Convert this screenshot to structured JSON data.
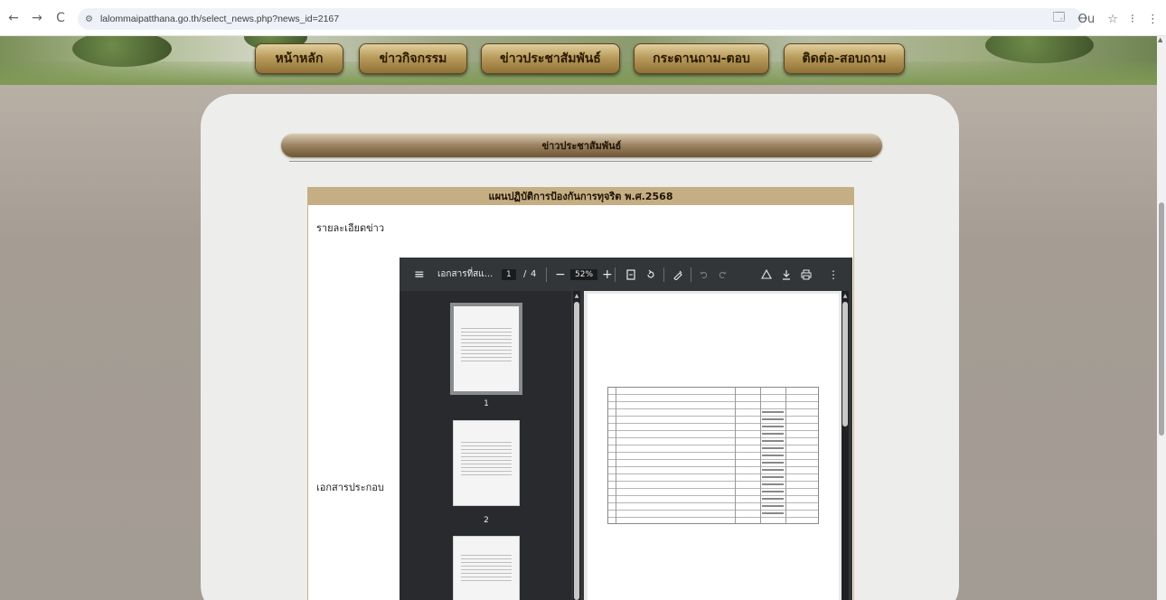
{
  "browser": {
    "url": "lalommaipatthana.go.th/select_news.php?news_id=2167",
    "back_icon": "←",
    "forward_icon": "→",
    "reload_icon": "C",
    "site_info_icon": "⚙",
    "translate_icon": "🗔",
    "profile_icon": "Ꝋu",
    "bookmark_icon": "☆",
    "extensions_icon": "⁝",
    "menu_icon": "⋮"
  },
  "nav": {
    "items": [
      "หน้าหลัก",
      "ข่าวกิจกรรม",
      "ข่าวประชาสัมพันธ์",
      "กระดานถาม-ตอบ",
      "ติดต่อ-สอบถาม"
    ]
  },
  "section": {
    "title": "ข่าวประชาสัมพันธ์"
  },
  "news": {
    "title": "แผนปฏิบัติการป้องกันการทุจริต พ.ศ.2568",
    "detail_label": "รายละเอียดข่าว",
    "attachment_label": "เอกสารประกอบ"
  },
  "pdf_viewer": {
    "menu_icon": "≡",
    "file_name": "เอกสารที่สแ...",
    "current_page": "1",
    "page_separator": "/",
    "total_pages": "4",
    "zoom_out": "−",
    "zoom_level": "52%",
    "zoom_in": "+",
    "thumbnails": [
      {
        "number": "1"
      },
      {
        "number": "2"
      }
    ]
  },
  "colors": {
    "nav_button": "#b99c5c",
    "news_header": "#c6ae84",
    "pdf_toolbar": "#323639"
  }
}
